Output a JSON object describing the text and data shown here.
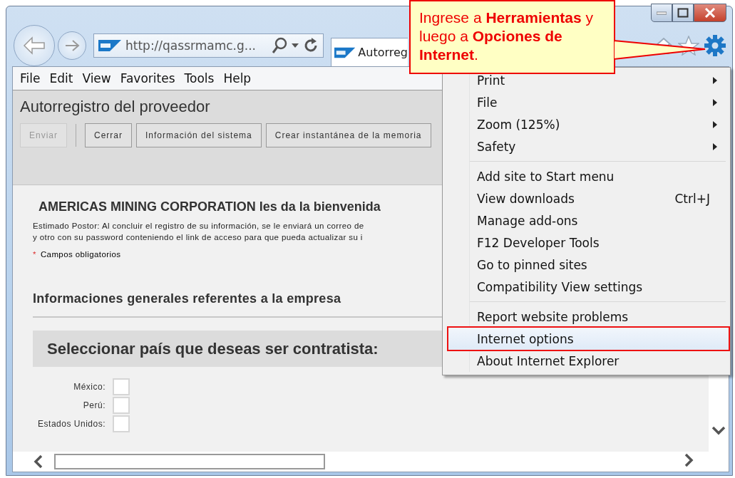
{
  "address_bar": {
    "url": "http://qassrmamc.g..."
  },
  "tab": {
    "title": "Autorreg",
    "selected": true
  },
  "menu_bar": [
    "File",
    "Edit",
    "View",
    "Favorites",
    "Tools",
    "Help"
  ],
  "page": {
    "title": "Autorregistro del proveedor",
    "toolbar": [
      {
        "label": "Enviar",
        "disabled": true
      },
      {
        "label": "Cerrar",
        "disabled": false
      },
      {
        "label": "Información del sistema",
        "disabled": false
      },
      {
        "label": "Crear instantánea de la memoria",
        "disabled": false
      }
    ],
    "welcome": "AMERICAS MINING CORPORATION les da la bienvenida",
    "intro_lines": [
      "Estimado Postor: Al concluir el registro de su información, se le enviará un correo de",
      "y otro con su password conteniendo el link de acceso para que pueda actualizar su i"
    ],
    "required_mark": "*",
    "required_note": "Campos obligatorios",
    "section_title": "Informaciones generales referentes a la empresa",
    "panel_title": "Seleccionar país que deseas ser contratista:",
    "countries": [
      {
        "label": "México:",
        "checked": false
      },
      {
        "label": "Perú:",
        "checked": false
      },
      {
        "label": "Estados Unidos:",
        "checked": false
      }
    ]
  },
  "tools_menu": {
    "groups": [
      [
        {
          "label": "Print",
          "submenu": true,
          "selected": false
        },
        {
          "label": "File",
          "submenu": true,
          "selected": false
        },
        {
          "label": "Zoom (125%)",
          "submenu": true,
          "selected": false
        },
        {
          "label": "Safety",
          "submenu": true,
          "selected": false
        }
      ],
      [
        {
          "label": "Add site to Start menu",
          "submenu": false,
          "selected": false
        },
        {
          "label": "View downloads",
          "shortcut": "Ctrl+J",
          "submenu": false,
          "selected": false
        },
        {
          "label": "Manage add-ons",
          "submenu": false,
          "selected": false
        },
        {
          "label": "F12 Developer Tools",
          "submenu": false,
          "selected": false
        },
        {
          "label": "Go to pinned sites",
          "submenu": false,
          "selected": false
        },
        {
          "label": "Compatibility View settings",
          "submenu": false,
          "selected": false
        }
      ],
      [
        {
          "label": "Report website problems",
          "submenu": false,
          "selected": false
        },
        {
          "label": "Internet options",
          "submenu": false,
          "selected": true
        },
        {
          "label": "About Internet Explorer",
          "submenu": false,
          "selected": false
        }
      ]
    ]
  },
  "callout": {
    "text": "Ingrese a **Herramientas** y luego a **Opciones de Internet**."
  }
}
